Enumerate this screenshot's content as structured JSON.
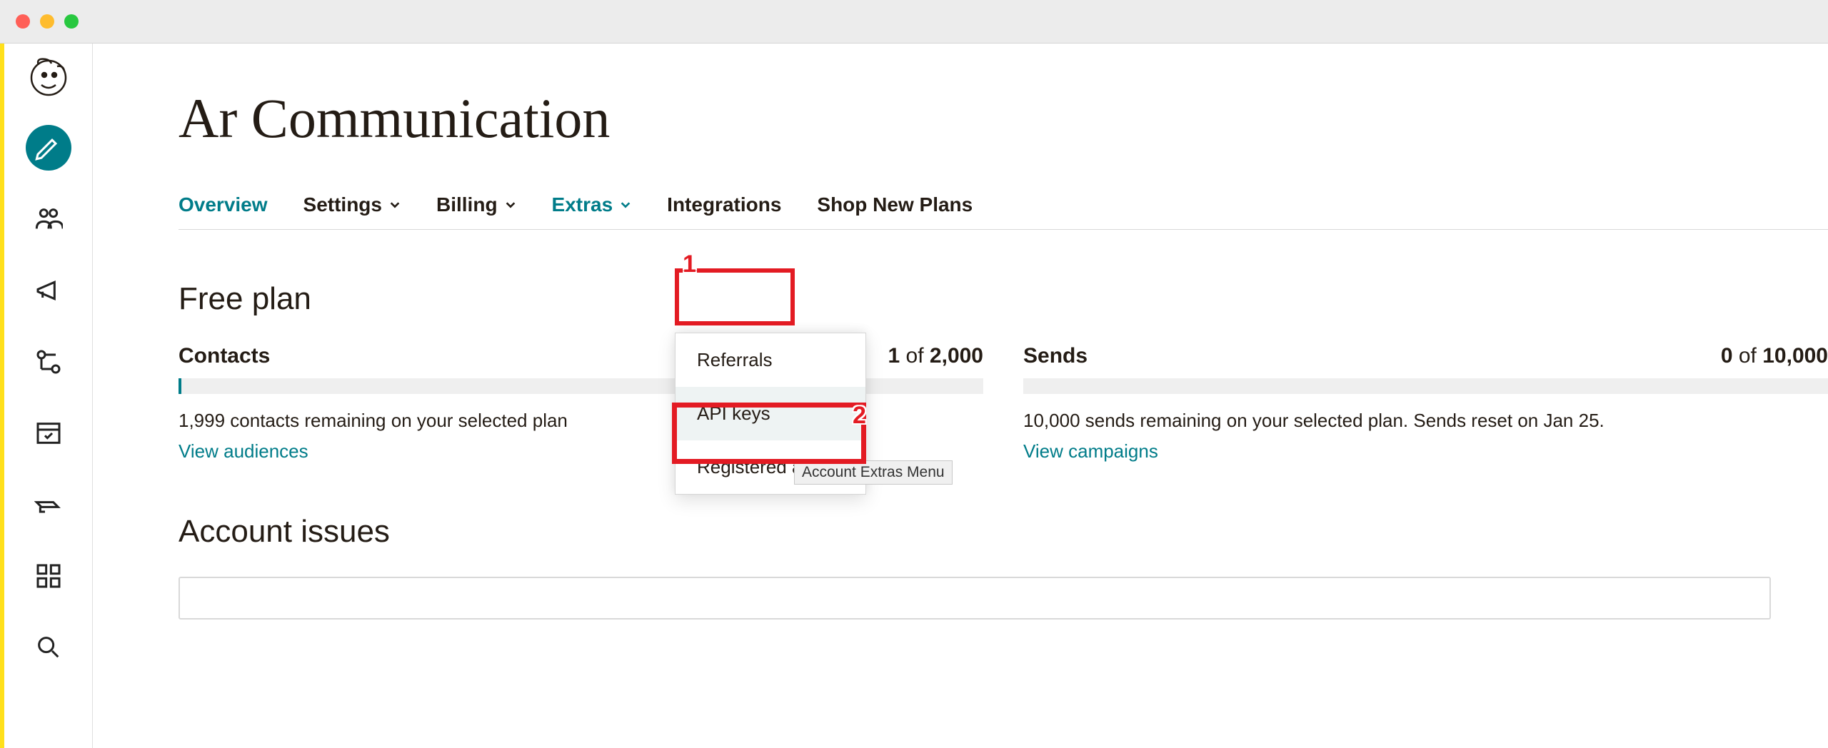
{
  "page_title": "Ar Communication",
  "tabs": {
    "overview": "Overview",
    "settings": "Settings",
    "billing": "Billing",
    "extras": "Extras",
    "integrations": "Integrations",
    "shop": "Shop New Plans"
  },
  "extras_menu": {
    "referrals": "Referrals",
    "api_keys": "API keys",
    "registered_apps": "Registered apps"
  },
  "tooltip": "Account Extras Menu",
  "plan_heading": "Free plan",
  "contacts": {
    "label": "Contacts",
    "used": "1",
    "of_word": "of",
    "total": "2,000",
    "desc": "1,999 contacts remaining on your selected plan",
    "link": "View audiences"
  },
  "sends": {
    "label": "Sends",
    "used": "0",
    "of_word": "of",
    "total": "10,000",
    "desc": "10,000 sends remaining on your selected plan. Sends reset on Jan 25.",
    "link": "View campaigns"
  },
  "issues_heading": "Account issues",
  "annotations": {
    "n1": "1",
    "n2": "2"
  }
}
